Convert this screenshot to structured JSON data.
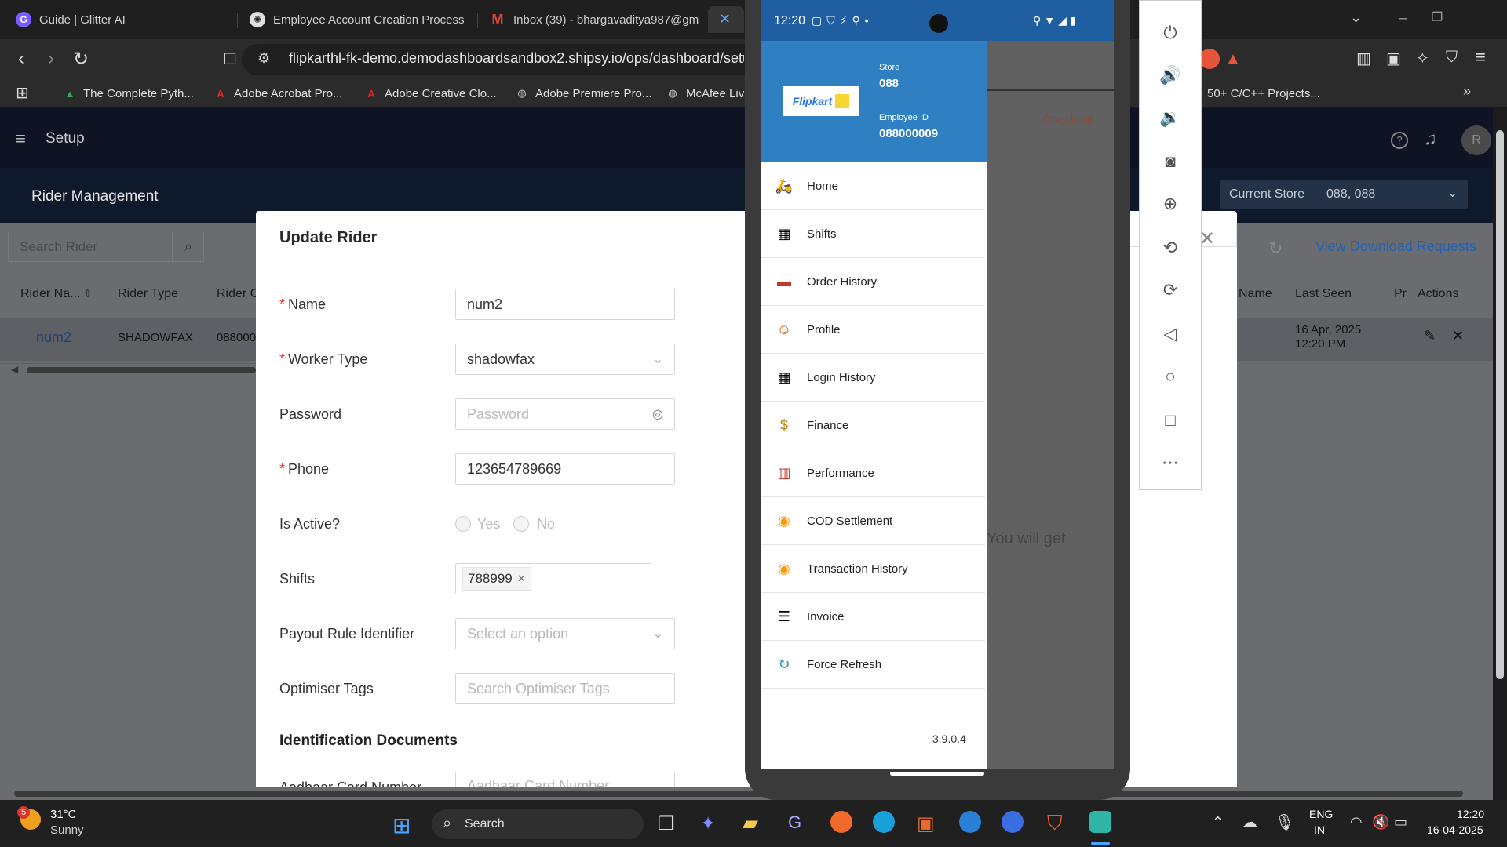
{
  "browser": {
    "tabs": [
      {
        "title": "Guide | Glitter AI",
        "icon": "glitter-icon",
        "color": "#7b5cff"
      },
      {
        "title": "Employee Account Creation Process",
        "icon": "chatgpt-icon",
        "color": "#e0e0e0"
      },
      {
        "title": "Inbox (39) - bhargavaditya987@gm",
        "icon": "gmail-icon",
        "color": "#ea4335"
      }
    ],
    "url": "flipkarthl-fk-demo.demodashboardsandbox2.shipsy.io/ops/dashboard/setu",
    "bookmarks": [
      {
        "label": "The Complete Pyth...",
        "icon": "drive-icon"
      },
      {
        "label": "Adobe Acrobat Pro...",
        "icon": "adobe-icon"
      },
      {
        "label": "Adobe Creative Clo...",
        "icon": "adobe-icon"
      },
      {
        "label": "Adobe Premiere Pro...",
        "icon": "globe-icon"
      },
      {
        "label": "McAfee Liv",
        "icon": "globe-icon"
      },
      {
        "label": "50+ C/C++ Projects...",
        "icon": "bookmark-icon"
      }
    ]
  },
  "app": {
    "setup_label": "Setup",
    "avatar_letter": "R",
    "page_title": "Rider Management",
    "current_store_label": "Current Store",
    "current_store_value": "088, 088",
    "search_placeholder": "Search Rider",
    "view_download": "View Download Requests",
    "checkout_label": "Checkout",
    "you_will_get": "You will get",
    "table": {
      "headers_left": [
        "Rider Na...",
        "Rider Type",
        "Rider C"
      ],
      "headers_right": [
        "Name",
        "Last Seen",
        "Pr",
        "Actions"
      ],
      "row": {
        "name": "num2",
        "type": "SHADOWFAX",
        "code": "088000",
        "last_seen_date": "16 Apr, 2025",
        "last_seen_time": "12:20 PM"
      }
    }
  },
  "modal": {
    "title": "Update Rider",
    "fields": {
      "name_label": "Name",
      "name_value": "num2",
      "worker_label": "Worker Type",
      "worker_value": "shadowfax",
      "password_label": "Password",
      "password_placeholder": "Password",
      "phone_label": "Phone",
      "phone_value": "123654789669",
      "active_label": "Is Active?",
      "active_yes": "Yes",
      "active_no": "No",
      "shifts_label": "Shifts",
      "shift_tag": "788999",
      "payout_label": "Payout Rule Identifier",
      "payout_placeholder": "Select an option",
      "tags_label": "Optimiser Tags",
      "tags_placeholder": "Search Optimiser Tags"
    },
    "section_title": "Identification Documents",
    "aadhaar_label": "Aadhaar Card Number",
    "aadhaar_placeholder": "Aadhaar Card Number"
  },
  "phone": {
    "time": "12:20",
    "store_label": "Store",
    "store_value": "088",
    "employee_label": "Employee ID",
    "employee_value": "088000009",
    "logo_text": "Flipkart",
    "menu": [
      {
        "label": "Home",
        "icon": "home-icon"
      },
      {
        "label": "Shifts",
        "icon": "calendar-icon"
      },
      {
        "label": "Order History",
        "icon": "truck-icon"
      },
      {
        "label": "Profile",
        "icon": "person-icon"
      },
      {
        "label": "Login History",
        "icon": "calendar-icon"
      },
      {
        "label": "Finance",
        "icon": "money-bag-icon"
      },
      {
        "label": "Performance",
        "icon": "chart-icon"
      },
      {
        "label": "COD Settlement",
        "icon": "coin-icon"
      },
      {
        "label": "Transaction History",
        "icon": "coin-icon"
      },
      {
        "label": "Invoice",
        "icon": "invoice-icon"
      },
      {
        "label": "Force Refresh",
        "icon": "refresh-icon"
      }
    ],
    "version": "3.9.0.4"
  },
  "taskbar": {
    "temperature": "31°C",
    "weather": "Sunny",
    "weather_badge": "5",
    "search_label": "Search",
    "lang_top": "ENG",
    "lang_bottom": "IN",
    "time": "12:20",
    "date": "16-04-2025"
  },
  "colors": {
    "link": "#1e63b8",
    "drawer_blue": "#2f7fc3",
    "required": "#e53935"
  }
}
